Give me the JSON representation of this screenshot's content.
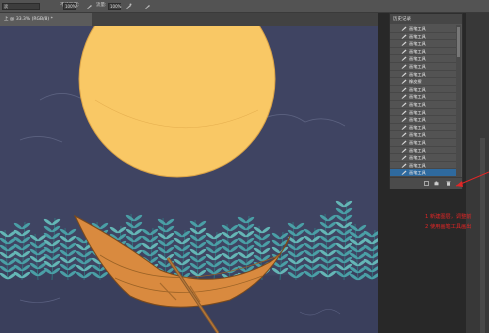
{
  "options_bar": {
    "mode_value": "滨",
    "opacity_label": "不透明度:",
    "opacity_value": "100%",
    "flow_label": "流量:",
    "flow_value": "100%"
  },
  "document_tab": {
    "title": "上 @ 33.3% (RGB/8) *"
  },
  "history_panel": {
    "title": "历史记录",
    "items": [
      {
        "label": "画笔工具",
        "selected": false
      },
      {
        "label": "画笔工具",
        "selected": false
      },
      {
        "label": "画笔工具",
        "selected": false
      },
      {
        "label": "画笔工具",
        "selected": false
      },
      {
        "label": "画笔工具",
        "selected": false
      },
      {
        "label": "画笔工具",
        "selected": false
      },
      {
        "label": "画笔工具",
        "selected": false
      },
      {
        "label": "橡皮擦",
        "selected": false
      },
      {
        "label": "画笔工具",
        "selected": false
      },
      {
        "label": "画笔工具",
        "selected": false
      },
      {
        "label": "画笔工具",
        "selected": false
      },
      {
        "label": "画笔工具",
        "selected": false
      },
      {
        "label": "画笔工具",
        "selected": false
      },
      {
        "label": "画笔工具",
        "selected": false
      },
      {
        "label": "画笔工具",
        "selected": false
      },
      {
        "label": "画笔工具",
        "selected": false
      },
      {
        "label": "画笔工具",
        "selected": false
      },
      {
        "label": "画笔工具",
        "selected": false
      },
      {
        "label": "画笔工具",
        "selected": false
      },
      {
        "label": "画笔工具",
        "selected": true
      }
    ]
  },
  "annotation": {
    "line1": "1 新建图层，调整前",
    "line2": "2 使用画笔工具画出"
  },
  "colors": {
    "canvas_bg": "#3f4462",
    "moon": "#f9c865",
    "boat": "#d98a3f",
    "leaves": "#4a9fa6",
    "annotation": "#e32626",
    "selected_row": "#2f6a9e"
  }
}
